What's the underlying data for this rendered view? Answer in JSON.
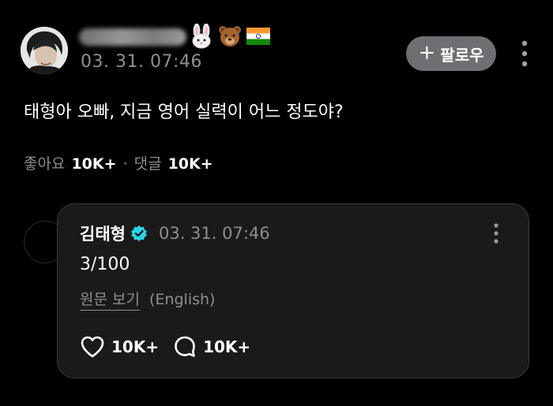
{
  "post": {
    "emojis": [
      "rabbit-face",
      "bear-face",
      "india-flag"
    ],
    "timestamp": "03. 31. 07:46",
    "follow_label": "팔로우",
    "text": "태형아 오빠, 지금 영어 실력이 어느 정도야?",
    "likes_label": "좋아요",
    "likes_count": "10K+",
    "separator": "·",
    "comments_label": "댓글",
    "comments_count": "10K+"
  },
  "reply": {
    "author": "김태형",
    "timestamp": "03. 31. 07:46",
    "text": "3/100",
    "translate_label": "원문 보기",
    "translate_language": "(English)",
    "like_count": "10K+",
    "comment_count": "10K+"
  },
  "colors": {
    "background": "#000000",
    "card": "#1a1a1a",
    "muted_text": "#8e8e93",
    "follow_button": "#6e6e73",
    "verified": "#2dd4e6"
  }
}
